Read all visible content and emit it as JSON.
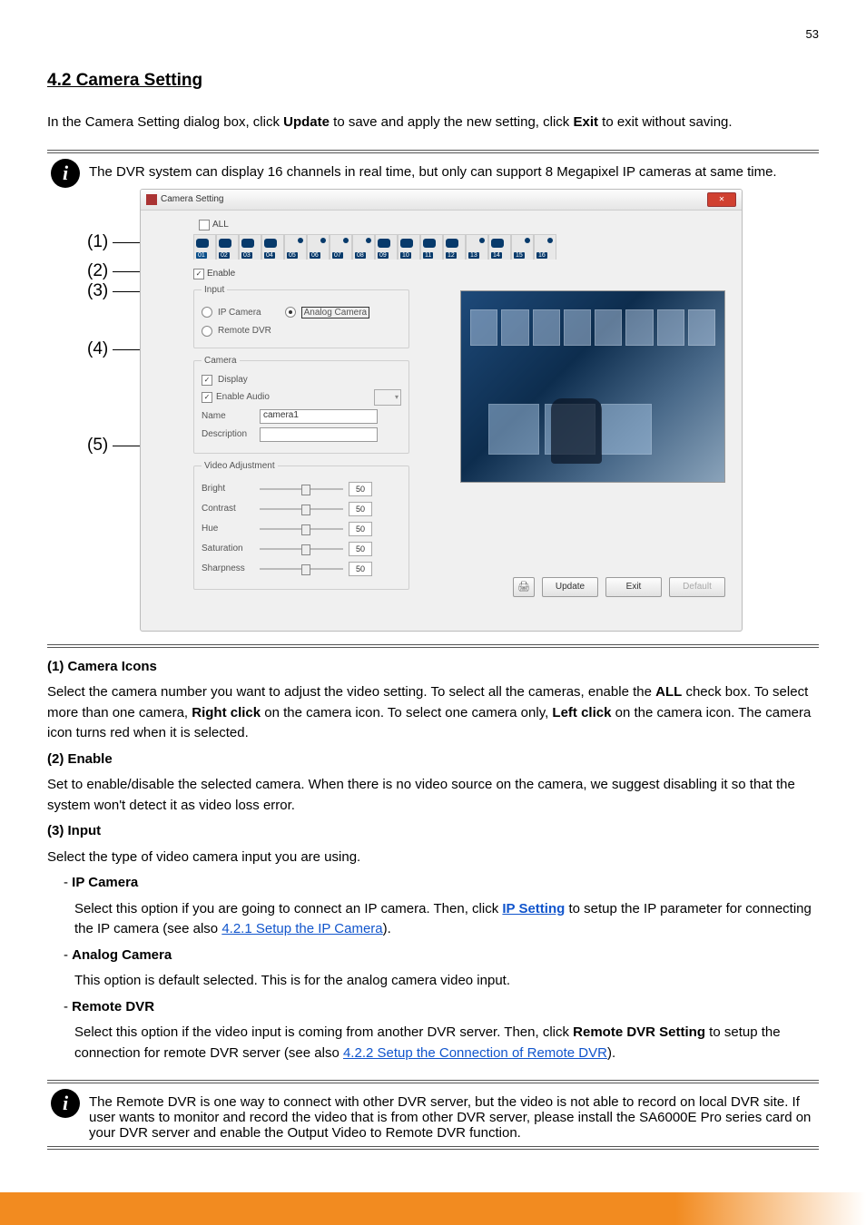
{
  "page_number": "53",
  "section_title": "4.2 Camera Setting",
  "top_note": "The DVR system can display 16 channels in real time, but only can support 8 Megapixel IP cameras at same time.",
  "callouts": {
    "c1": "(1)",
    "c2": "(2)",
    "c3": "(3)",
    "c4": "(4)",
    "c5": "(5)"
  },
  "shot": {
    "title": "Camera Setting",
    "all": "ALL",
    "enable": "Enable",
    "groups": {
      "input": {
        "legend": "Input",
        "ip": "IP Camera",
        "analog": "Analog Camera",
        "remote": "Remote DVR"
      },
      "camera": {
        "legend": "Camera",
        "display": "Display",
        "enable_audio": "Enable Audio",
        "name_lbl": "Name",
        "name_val": "camera1",
        "desc_lbl": "Description"
      },
      "video": {
        "legend": "Video Adjustment",
        "bright": "Bright",
        "contrast": "Contrast",
        "hue": "Hue",
        "saturation": "Saturation",
        "sharpness": "Sharpness",
        "val": "50"
      }
    },
    "buttons": {
      "update": "Update",
      "exit": "Exit",
      "default": "Default"
    }
  },
  "list": {
    "i1_label": "(1) Camera Icons",
    "i1_text": "Select the camera number you want to adjust the video setting. To select all the cameras, enable the ALL check box. To select more than one camera, Right click on the camera icon. To select one camera only, Left click on the camera icon. The camera icon turns red when it is selected.",
    "i2_label": "(2) Enable",
    "i2_text_a": "Set to enable/disable the selected camera. When there is no video source on the camera, we suggest disabling it so that the system won't detect it as video loss error.",
    "i3_label": "(3) Input",
    "i3_text": "Select the type of video camera input you are using.",
    "ip_label": "IP Camera",
    "ip_text_a": "Select this option if you are going to connect an IP camera. Then, click ",
    "ip_link": "IP Setting",
    "ip_text_b": " to setup the IP parameter for connecting the IP camera (see also ",
    "ip_link2": "4.2.1 Setup the IP Camera",
    "ip_text_c": ").",
    "analog_label": "Analog Camera",
    "analog_text": "This option is default selected. This is for the analog camera video input.",
    "remote_label": "Remote DVR",
    "remote_text_a": "Select this option if the video input is coming from another DVR server. Then, click ",
    "remote_text_b": " to setup the connection for remote DVR server (see also ",
    "remote_link": "4.2.2 Setup the Connection of Remote DVR",
    "remote_text_c": ")."
  },
  "bottom_note": "The Remote DVR is one way to connect with other DVR server, but the video is not able to record on local DVR site. If user wants to monitor and record the video that is from other DVR server, please install the SA6000E Pro series card on your DVR server and enable the Output Video to Remote DVR function."
}
